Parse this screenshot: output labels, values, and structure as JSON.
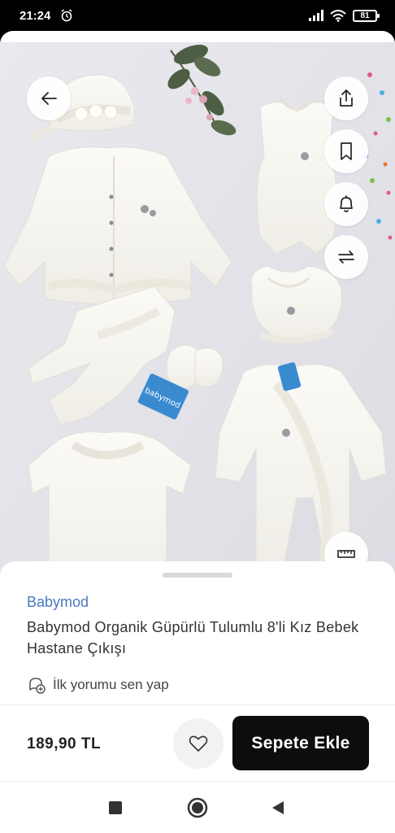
{
  "status_bar": {
    "time": "21:24",
    "battery": "81",
    "icons": [
      "alarm-icon",
      "signal-icon",
      "wifi-icon",
      "battery-icon"
    ]
  },
  "product_image": {
    "brand_tag_text": "babymod"
  },
  "image_actions": {
    "icons": [
      "back-arrow-icon",
      "share-icon",
      "bookmark-icon",
      "bell-icon",
      "compare-icon",
      "ruler-icon"
    ]
  },
  "product": {
    "brand": "Babymod",
    "title": "Babymod Organik Güpürlü Tulumlu 8'li Kız Bebek Hastane Çıkışı",
    "review_prompt": "İlk yorumu sen yap",
    "price": "189,90 TL"
  },
  "actions": {
    "add_to_cart": "Sepete Ekle"
  },
  "colors": {
    "brand_link": "#4a78c0",
    "cta_bg": "#0d0d0d",
    "image_bg": "#e4e4ea"
  },
  "nav": {
    "icons": [
      "recents-square-icon",
      "home-circle-icon",
      "back-triangle-icon"
    ]
  }
}
